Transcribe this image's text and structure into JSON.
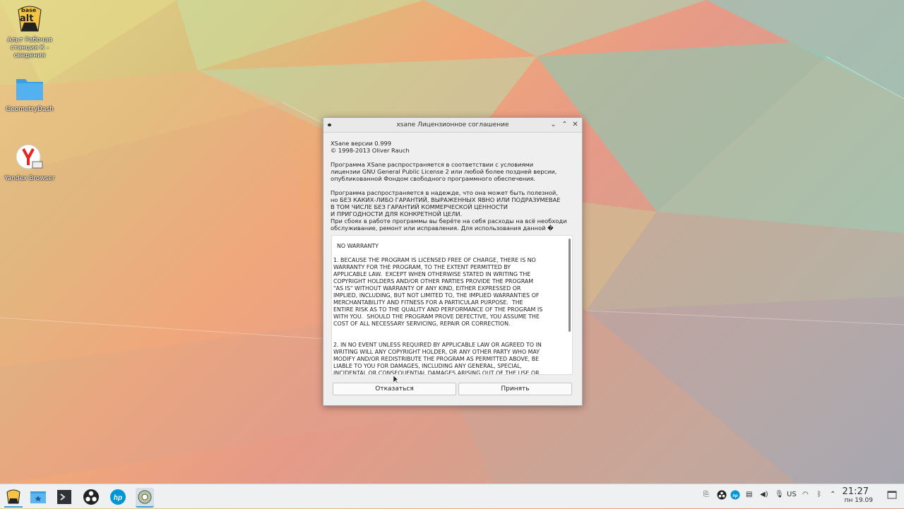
{
  "desktop": {
    "icons": [
      {
        "label_line1": "Альт Рабочая",
        "label_line2": "станция К -",
        "label_line3": "сведения",
        "badge_top": "base",
        "badge_bottom": "alt"
      },
      {
        "label": "GeometryDash"
      },
      {
        "label": "Yandex Browser"
      }
    ]
  },
  "window": {
    "title": "xsane Лицензионное соглашение",
    "lines": [
      "XSane версии 0.999",
      "© 1998-2013 Oliver Rauch",
      "Программа XSane распространяется в соответствии с условиями",
      "лицензии GNU General Public License 2 или любой более поздней версии,",
      "опубликованной Фондом свободного программного обеспечения.",
      "Программа распространяется в надежде, что она может быть полезной,",
      "но БЕЗ КАКИХ-ЛИБО ГАРАНТИЙ, ВЫРАЖЕННЫХ ЯВНО ИЛИ ПОДРАЗУМЕВАЕ",
      "В ТОМ ЧИСЛЕ БЕЗ ГАРАНТИЙ КОММЕРЧЕСКОЙ ЦЕННОСТИ",
      "И ПРИГОДНОСТИ ДЛЯ КОНКРЕТНОЙ ЦЕЛИ.",
      "При сбоях в работе программы вы берёте на себя расходы на всё необходи",
      "обслуживание, ремонт или исправления. Для использования данной �"
    ],
    "license_text": "  NO WARRANTY\n\n1. BECAUSE THE PROGRAM IS LICENSED FREE OF CHARGE, THERE IS NO\nWARRANTY FOR THE PROGRAM, TO THE EXTENT PERMITTED BY\nAPPLICABLE LAW.  EXCEPT WHEN OTHERWISE STATED IN WRITING THE\nCOPYRIGHT HOLDERS AND/OR OTHER PARTIES PROVIDE THE PROGRAM\n\"AS IS\" WITHOUT WARRANTY OF ANY KIND, EITHER EXPRESSED OR\nIMPLIED, INCLUDING, BUT NOT LIMITED TO, THE IMPLIED WARRANTIES OF\nMERCHANTABILITY AND FITNESS FOR A PARTICULAR PURPOSE.  THE\nENTIRE RISK AS TO THE QUALITY AND PERFORMANCE OF THE PROGRAM IS\nWITH YOU.  SHOULD THE PROGRAM PROVE DEFECTIVE, YOU ASSUME THE\nCOST OF ALL NECESSARY SERVICING, REPAIR OR CORRECTION.\n\n\n2. IN NO EVENT UNLESS REQUIRED BY APPLICABLE LAW OR AGREED TO IN\nWRITING WILL ANY COPYRIGHT HOLDER, OR ANY OTHER PARTY WHO MAY\nMODIFY AND/OR REDISTRIBUTE THE PROGRAM AS PERMITTED ABOVE, BE\nLIABLE TO YOU FOR DAMAGES, INCLUDING ANY GENERAL, SPECIAL,\nINCIDENTAL OR CONSEQUENTIAL DAMAGES ARISING OUT OF THE USE OR",
    "decline_label": "Отказаться",
    "accept_label": "Принять"
  },
  "taskbar": {
    "apps": [
      "alt-menu",
      "file-manager",
      "terminal",
      "obs",
      "hp",
      "xsane"
    ],
    "tray": {
      "keyboard_layout": "US",
      "time": "21:27",
      "date": "пн 19.09"
    }
  },
  "colors": {
    "window_bg": "#efefef",
    "taskbar_bg": "#eef0f2",
    "folder_blue": "#3d9ee0"
  }
}
